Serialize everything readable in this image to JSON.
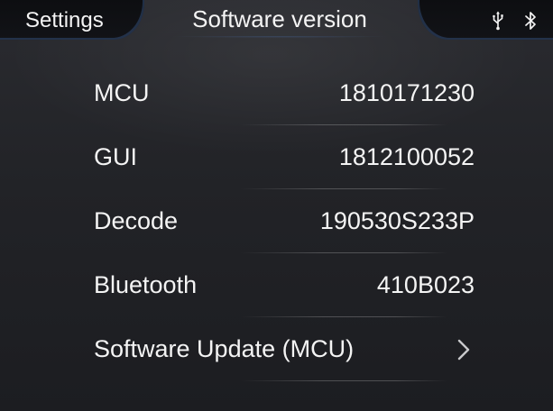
{
  "header": {
    "back_label": "Settings",
    "title": "Software version",
    "status_icons": [
      "usb-icon",
      "bluetooth-icon"
    ]
  },
  "versions": [
    {
      "label": "MCU",
      "value": "1810171230"
    },
    {
      "label": "GUI",
      "value": "1812100052"
    },
    {
      "label": "Decode",
      "value": "190530S233P"
    },
    {
      "label": "Bluetooth",
      "value": "410B023"
    }
  ],
  "update": {
    "label": "Software Update (MCU)",
    "icon": "chevron-right-icon"
  },
  "colors": {
    "background": "#222327",
    "bar": "#0f1013",
    "accent_glow": "#466eaa",
    "text": "#f4f4f4"
  }
}
